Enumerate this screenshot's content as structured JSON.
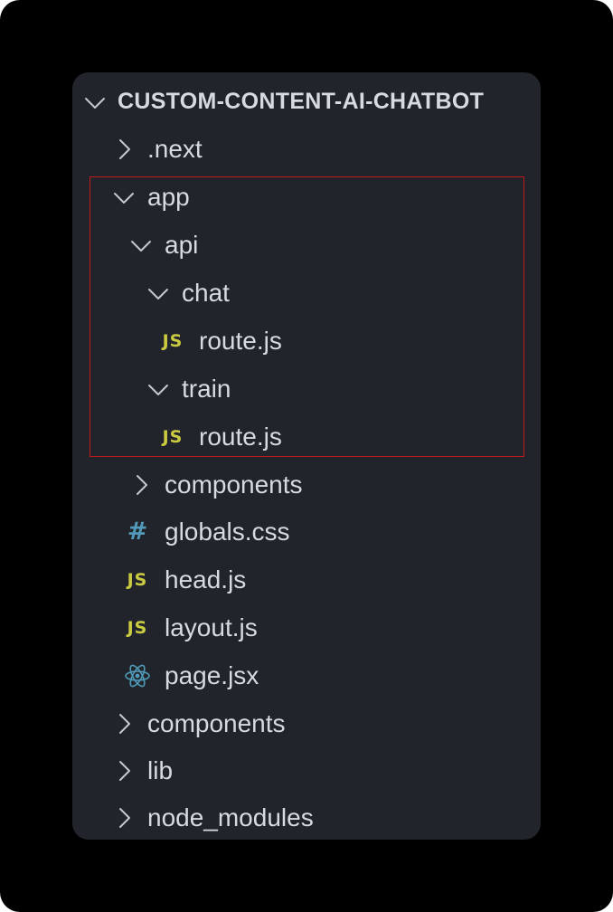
{
  "explorer": {
    "root": {
      "label": "CUSTOM-CONTENT-AI-CHATBOT",
      "expanded": true
    },
    "items": [
      {
        "label": ".next",
        "type": "folder",
        "expanded": false
      },
      {
        "label": "app",
        "type": "folder",
        "expanded": true
      },
      {
        "label": "api",
        "type": "folder",
        "expanded": true
      },
      {
        "label": "chat",
        "type": "folder",
        "expanded": true
      },
      {
        "label": "route.js",
        "type": "file",
        "icon": "js-file-icon",
        "icon_text": "JS"
      },
      {
        "label": "train",
        "type": "folder",
        "expanded": true
      },
      {
        "label": "route.js",
        "type": "file",
        "icon": "js-file-icon",
        "icon_text": "JS"
      },
      {
        "label": "components",
        "type": "folder",
        "expanded": false
      },
      {
        "label": "globals.css",
        "type": "file",
        "icon": "css-file-icon",
        "icon_text": "#"
      },
      {
        "label": "head.js",
        "type": "file",
        "icon": "js-file-icon",
        "icon_text": "JS"
      },
      {
        "label": "layout.js",
        "type": "file",
        "icon": "js-file-icon",
        "icon_text": "JS"
      },
      {
        "label": "page.jsx",
        "type": "file",
        "icon": "react-file-icon"
      },
      {
        "label": "components",
        "type": "folder",
        "expanded": false
      },
      {
        "label": "lib",
        "type": "folder",
        "expanded": false
      },
      {
        "label": "node_modules",
        "type": "folder",
        "expanded": false
      }
    ]
  },
  "colors": {
    "background": "#000000",
    "panel": "#21252b",
    "text": "#d7dae0",
    "chevron": "#c5c8ce",
    "js_icon": "#cbcb41",
    "css_icon": "#519aba",
    "react_icon": "#519aba",
    "highlight_border": "#c21a1a"
  }
}
